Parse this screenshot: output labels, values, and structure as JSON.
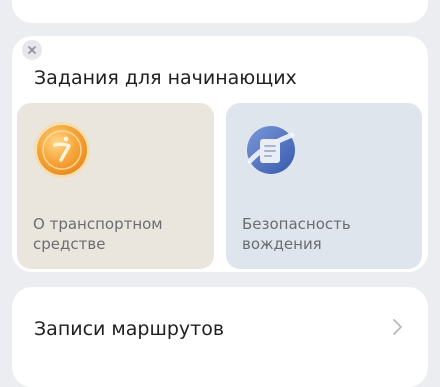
{
  "colors": {
    "page_background": "#ecedf1",
    "card_background": "#ffffff",
    "vehicle_tile_background": "#ebe6dd",
    "safety_tile_background": "#dfe5ed",
    "vehicle_icon_accent": "#f6a53a",
    "safety_icon_accent": "#4a6fc2"
  },
  "beginner_tasks": {
    "title": "Задания для начинающих",
    "close_icon": "close-icon",
    "tiles": [
      {
        "icon": "vehicle-coin-icon",
        "label": "О транспортном средстве"
      },
      {
        "icon": "safety-document-icon",
        "label": "Безопасность вождения"
      }
    ]
  },
  "route_records": {
    "title": "Записи маршрутов",
    "chevron_icon": "chevron-right-icon"
  }
}
